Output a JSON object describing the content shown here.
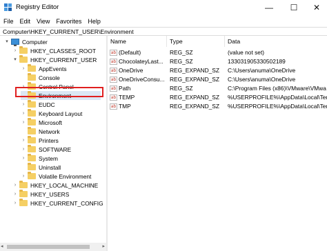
{
  "window": {
    "title": "Registry Editor",
    "minimize": "—",
    "maximize": "☐",
    "close": "✕"
  },
  "menu": [
    "File",
    "Edit",
    "View",
    "Favorites",
    "Help"
  ],
  "address": "Computer\\HKEY_CURRENT_USER\\Environment",
  "tree": {
    "root": "Computer",
    "hives": [
      "HKEY_CLASSES_ROOT",
      "HKEY_CURRENT_USER",
      "HKEY_LOCAL_MACHINE",
      "HKEY_USERS",
      "HKEY_CURRENT_CONFIG"
    ],
    "hkcu_children": [
      "AppEvents",
      "Console",
      "Control Panel",
      "Environment",
      "EUDC",
      "Keyboard Layout",
      "Microsoft",
      "Network",
      "Printers",
      "SOFTWARE",
      "System",
      "Uninstall",
      "Volatile Environment"
    ],
    "selected": "Environment"
  },
  "columns": {
    "name": "Name",
    "type": "Type",
    "data": "Data"
  },
  "values": [
    {
      "name": "(Default)",
      "type": "REG_SZ",
      "data": "(value not set)"
    },
    {
      "name": "ChocolateyLast...",
      "type": "REG_SZ",
      "data": "133031905330502189"
    },
    {
      "name": "OneDrive",
      "type": "REG_EXPAND_SZ",
      "data": "C:\\Users\\anuma\\OneDrive"
    },
    {
      "name": "OneDriveConsu...",
      "type": "REG_EXPAND_SZ",
      "data": "C:\\Users\\anuma\\OneDrive"
    },
    {
      "name": "Path",
      "type": "REG_SZ",
      "data": "C:\\Program Files (x86)\\VMware\\VMwa"
    },
    {
      "name": "TEMP",
      "type": "REG_EXPAND_SZ",
      "data": "%USERPROFILE%\\AppData\\Local\\Tem"
    },
    {
      "name": "TMP",
      "type": "REG_EXPAND_SZ",
      "data": "%USERPROFILE%\\AppData\\Local\\Tem"
    }
  ],
  "value_icon_text": "ab"
}
